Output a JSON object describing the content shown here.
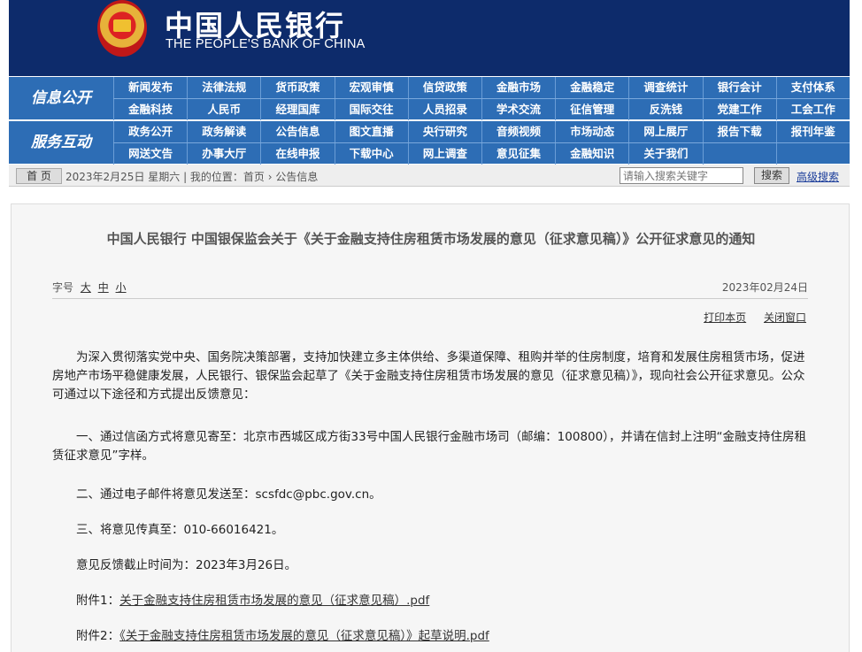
{
  "header": {
    "title_cn": "中国人民银行",
    "title_en": "THE PEOPLE'S BANK OF CHINA",
    "emblem_icon": "national-emblem-icon"
  },
  "nav": {
    "section1_label": "信息公开",
    "section2_label": "服务互动",
    "rows": [
      [
        "新闻发布",
        "法律法规",
        "货币政策",
        "宏观审慎",
        "信贷政策",
        "金融市场",
        "金融稳定",
        "调查统计",
        "银行会计",
        "支付体系"
      ],
      [
        "金融科技",
        "人民币",
        "经理国库",
        "国际交往",
        "人员招录",
        "学术交流",
        "征信管理",
        "反洗钱",
        "党建工作",
        "工会工作"
      ],
      [
        "政务公开",
        "政务解读",
        "公告信息",
        "图文直播",
        "央行研究",
        "音频视频",
        "市场动态",
        "网上展厅",
        "报告下载",
        "报刊年鉴"
      ],
      [
        "网送文告",
        "办事大厅",
        "在线申报",
        "下载中心",
        "网上调查",
        "意见征集",
        "金融知识",
        "关于我们",
        "",
        ""
      ]
    ]
  },
  "toolbar": {
    "home_label": "首 页",
    "crumb": "2023年2月25日  星期六 | 我的位置：首页  ›  公告信息",
    "search_placeholder": "请输入搜索关键字",
    "search_label": "搜索",
    "advanced_label": "高级搜索"
  },
  "article": {
    "title": "中国人民银行 中国银保监会关于《关于金融支持住房租赁市场发展的意见（征求意见稿）》公开征求意见的通知",
    "font_size_label": "字号",
    "font_large": "大",
    "font_medium": "中",
    "font_small": "小",
    "date": "2023年02月24日",
    "print_label": "打印本页",
    "close_label": "关闭窗口",
    "paragraphs": {
      "p1": "为深入贯彻落实党中央、国务院决策部署，支持加快建立多主体供给、多渠道保障、租购并举的住房制度，培育和发展住房租赁市场，促进房地产市场平稳健康发展，人民银行、银保监会起草了《关于金融支持住房租赁市场发展的意见（征求意见稿）》，现向社会公开征求意见。公众可通过以下途径和方式提出反馈意见：",
      "p2": "一、通过信函方式将意见寄至：北京市西城区成方街33号中国人民银行金融市场司（邮编：100800），并请在信封上注明“金融支持住房租赁征求意见”字样。",
      "p3": "二、通过电子邮件将意见发送至：scsfdc@pbc.gov.cn。",
      "p4": "三、将意见传真至：010-66016421。",
      "p5": "意见反馈截止时间为：2023年3月26日。",
      "att1_prefix": "附件1：",
      "att1_link": "关于金融支持住房租赁市场发展的意见（征求意见稿）.pdf",
      "att2_prefix": "附件2：",
      "att2_link": "《关于金融支持住房租赁市场发展的意见（征求意见稿）》起草说明.pdf"
    }
  }
}
